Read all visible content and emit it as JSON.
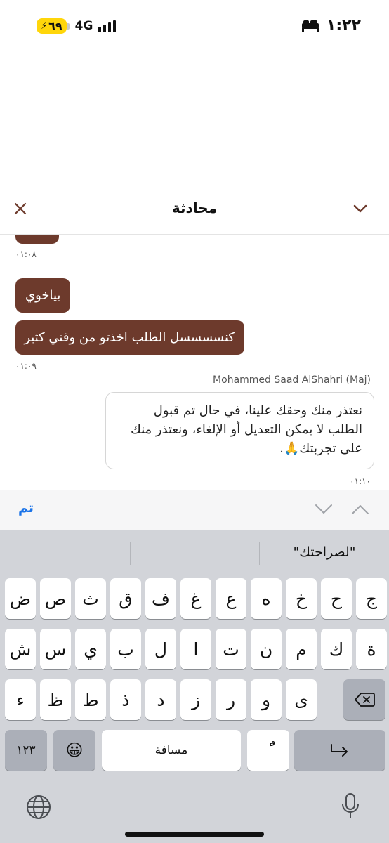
{
  "status_bar": {
    "time": "١:٢٢",
    "network": "4G",
    "battery": "٦٩"
  },
  "header": {
    "title": "محادثة"
  },
  "messages": {
    "ts_1": "٠١:٠٨",
    "msg_1": "يياخوي",
    "msg_2": "كنسسسسل الطلب اخذتو من وقتي كثير",
    "ts_2": "٠١:٠٩",
    "sender": "Mohammed Saad AlShahri (Maj)",
    "incoming_text": "نعتذر منك وحقك علينا، في حال تم قبول الطلب لا يمكن التعديل أو الإلغاء، ونعتذر منك على تجربتك🙏.",
    "ts_3": "٠١:١٠"
  },
  "accessory_bar": {
    "done_label": "تم"
  },
  "keyboard": {
    "predictions": [
      "\"لصراحتك\"",
      "",
      ""
    ],
    "row1": [
      "ض",
      "ص",
      "ث",
      "ق",
      "ف",
      "غ",
      "ع",
      "ه",
      "خ",
      "ح",
      "ج"
    ],
    "row2": [
      "ش",
      "س",
      "ي",
      "ب",
      "ل",
      "ا",
      "ت",
      "ن",
      "م",
      "ك",
      "ة"
    ],
    "row3": [
      "ء",
      "ظ",
      "ط",
      "ذ",
      "د",
      "ز",
      "ر",
      "و",
      "ى"
    ],
    "numbers_label": "١٢٣",
    "emoji_label": "😀",
    "space_label": "مسافة",
    "tanween_label": "ًٌ"
  }
}
